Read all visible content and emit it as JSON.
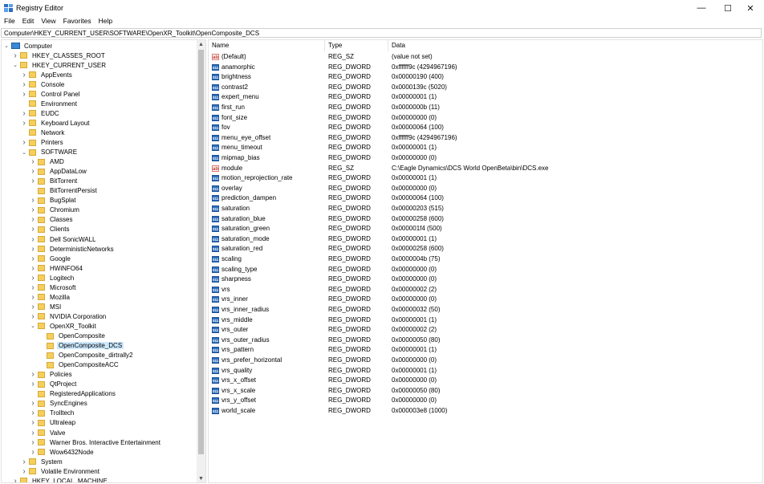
{
  "window": {
    "title": "Registry Editor",
    "minimize_glyph": "—",
    "maximize_glyph": "☐",
    "close_glyph": "✕"
  },
  "menu": [
    "File",
    "Edit",
    "View",
    "Favorites",
    "Help"
  ],
  "address_path": "Computer\\HKEY_CURRENT_USER\\SOFTWARE\\OpenXR_Toolkit\\OpenComposite_DCS",
  "tree": [
    {
      "label": "Computer",
      "depth": 0,
      "chev": "down",
      "icon": "computer"
    },
    {
      "label": "HKEY_CLASSES_ROOT",
      "depth": 1,
      "chev": "right"
    },
    {
      "label": "HKEY_CURRENT_USER",
      "depth": 1,
      "chev": "down"
    },
    {
      "label": "AppEvents",
      "depth": 2,
      "chev": "right"
    },
    {
      "label": "Console",
      "depth": 2,
      "chev": "right"
    },
    {
      "label": "Control Panel",
      "depth": 2,
      "chev": "right"
    },
    {
      "label": "Environment",
      "depth": 2,
      "chev": ""
    },
    {
      "label": "EUDC",
      "depth": 2,
      "chev": "right"
    },
    {
      "label": "Keyboard Layout",
      "depth": 2,
      "chev": "right"
    },
    {
      "label": "Network",
      "depth": 2,
      "chev": ""
    },
    {
      "label": "Printers",
      "depth": 2,
      "chev": "right"
    },
    {
      "label": "SOFTWARE",
      "depth": 2,
      "chev": "down"
    },
    {
      "label": "AMD",
      "depth": 3,
      "chev": "right"
    },
    {
      "label": "AppDataLow",
      "depth": 3,
      "chev": "right"
    },
    {
      "label": "BitTorrent",
      "depth": 3,
      "chev": "right"
    },
    {
      "label": "BitTorrentPersist",
      "depth": 3,
      "chev": ""
    },
    {
      "label": "BugSplat",
      "depth": 3,
      "chev": "right"
    },
    {
      "label": "Chromium",
      "depth": 3,
      "chev": "right"
    },
    {
      "label": "Classes",
      "depth": 3,
      "chev": "right"
    },
    {
      "label": "Clients",
      "depth": 3,
      "chev": "right"
    },
    {
      "label": "Dell SonicWALL",
      "depth": 3,
      "chev": "right"
    },
    {
      "label": "DeterministicNetworks",
      "depth": 3,
      "chev": "right"
    },
    {
      "label": "Google",
      "depth": 3,
      "chev": "right"
    },
    {
      "label": "HWiNFO64",
      "depth": 3,
      "chev": "right"
    },
    {
      "label": "Logitech",
      "depth": 3,
      "chev": "right"
    },
    {
      "label": "Microsoft",
      "depth": 3,
      "chev": "right"
    },
    {
      "label": "Mozilla",
      "depth": 3,
      "chev": "right"
    },
    {
      "label": "MSI",
      "depth": 3,
      "chev": "right"
    },
    {
      "label": "NVIDIA Corporation",
      "depth": 3,
      "chev": "right"
    },
    {
      "label": "OpenXR_Toolkit",
      "depth": 3,
      "chev": "down"
    },
    {
      "label": "OpenComposite",
      "depth": 4,
      "chev": ""
    },
    {
      "label": "OpenComposite_DCS",
      "depth": 4,
      "chev": "",
      "selected": true
    },
    {
      "label": "OpenComposite_dirtrally2",
      "depth": 4,
      "chev": ""
    },
    {
      "label": "OpenCompositeACC",
      "depth": 4,
      "chev": ""
    },
    {
      "label": "Policies",
      "depth": 3,
      "chev": "right"
    },
    {
      "label": "QtProject",
      "depth": 3,
      "chev": "right"
    },
    {
      "label": "RegisteredApplications",
      "depth": 3,
      "chev": ""
    },
    {
      "label": "SyncEngines",
      "depth": 3,
      "chev": "right"
    },
    {
      "label": "Trolltech",
      "depth": 3,
      "chev": "right"
    },
    {
      "label": "Ultraleap",
      "depth": 3,
      "chev": "right"
    },
    {
      "label": "Valve",
      "depth": 3,
      "chev": "right"
    },
    {
      "label": "Warner Bros. Interactive Entertainment",
      "depth": 3,
      "chev": "right"
    },
    {
      "label": "Wow6432Node",
      "depth": 3,
      "chev": "right"
    },
    {
      "label": "System",
      "depth": 2,
      "chev": "right"
    },
    {
      "label": "Volatile Environment",
      "depth": 2,
      "chev": "right"
    },
    {
      "label": "HKEY_LOCAL_MACHINE",
      "depth": 1,
      "chev": "right"
    }
  ],
  "columns": {
    "name": "Name",
    "type": "Type",
    "data": "Data"
  },
  "values": [
    {
      "name": "(Default)",
      "type": "REG_SZ",
      "data": "(value not set)",
      "icon": "sz"
    },
    {
      "name": "anamorphic",
      "type": "REG_DWORD",
      "data": "0xffffff9c (4294967196)",
      "icon": "dw"
    },
    {
      "name": "brightness",
      "type": "REG_DWORD",
      "data": "0x00000190 (400)",
      "icon": "dw"
    },
    {
      "name": "contrast2",
      "type": "REG_DWORD",
      "data": "0x0000139c (5020)",
      "icon": "dw"
    },
    {
      "name": "expert_menu",
      "type": "REG_DWORD",
      "data": "0x00000001 (1)",
      "icon": "dw"
    },
    {
      "name": "first_run",
      "type": "REG_DWORD",
      "data": "0x0000000b (11)",
      "icon": "dw"
    },
    {
      "name": "font_size",
      "type": "REG_DWORD",
      "data": "0x00000000 (0)",
      "icon": "dw"
    },
    {
      "name": "fov",
      "type": "REG_DWORD",
      "data": "0x00000064 (100)",
      "icon": "dw"
    },
    {
      "name": "menu_eye_offset",
      "type": "REG_DWORD",
      "data": "0xffffff9c (4294967196)",
      "icon": "dw"
    },
    {
      "name": "menu_timeout",
      "type": "REG_DWORD",
      "data": "0x00000001 (1)",
      "icon": "dw"
    },
    {
      "name": "mipmap_bias",
      "type": "REG_DWORD",
      "data": "0x00000000 (0)",
      "icon": "dw"
    },
    {
      "name": "module",
      "type": "REG_SZ",
      "data": "C:\\Eagle Dynamics\\DCS World OpenBeta\\bin\\DCS.exe",
      "icon": "sz"
    },
    {
      "name": "motion_reprojection_rate",
      "type": "REG_DWORD",
      "data": "0x00000001 (1)",
      "icon": "dw"
    },
    {
      "name": "overlay",
      "type": "REG_DWORD",
      "data": "0x00000000 (0)",
      "icon": "dw"
    },
    {
      "name": "prediction_dampen",
      "type": "REG_DWORD",
      "data": "0x00000064 (100)",
      "icon": "dw"
    },
    {
      "name": "saturation",
      "type": "REG_DWORD",
      "data": "0x00000203 (515)",
      "icon": "dw"
    },
    {
      "name": "saturation_blue",
      "type": "REG_DWORD",
      "data": "0x00000258 (600)",
      "icon": "dw"
    },
    {
      "name": "saturation_green",
      "type": "REG_DWORD",
      "data": "0x000001f4 (500)",
      "icon": "dw"
    },
    {
      "name": "saturation_mode",
      "type": "REG_DWORD",
      "data": "0x00000001 (1)",
      "icon": "dw"
    },
    {
      "name": "saturation_red",
      "type": "REG_DWORD",
      "data": "0x00000258 (600)",
      "icon": "dw"
    },
    {
      "name": "scaling",
      "type": "REG_DWORD",
      "data": "0x0000004b (75)",
      "icon": "dw"
    },
    {
      "name": "scaling_type",
      "type": "REG_DWORD",
      "data": "0x00000000 (0)",
      "icon": "dw"
    },
    {
      "name": "sharpness",
      "type": "REG_DWORD",
      "data": "0x00000000 (0)",
      "icon": "dw"
    },
    {
      "name": "vrs",
      "type": "REG_DWORD",
      "data": "0x00000002 (2)",
      "icon": "dw"
    },
    {
      "name": "vrs_inner",
      "type": "REG_DWORD",
      "data": "0x00000000 (0)",
      "icon": "dw"
    },
    {
      "name": "vrs_inner_radius",
      "type": "REG_DWORD",
      "data": "0x00000032 (50)",
      "icon": "dw"
    },
    {
      "name": "vrs_middle",
      "type": "REG_DWORD",
      "data": "0x00000001 (1)",
      "icon": "dw"
    },
    {
      "name": "vrs_outer",
      "type": "REG_DWORD",
      "data": "0x00000002 (2)",
      "icon": "dw"
    },
    {
      "name": "vrs_outer_radius",
      "type": "REG_DWORD",
      "data": "0x00000050 (80)",
      "icon": "dw"
    },
    {
      "name": "vrs_pattern",
      "type": "REG_DWORD",
      "data": "0x00000001 (1)",
      "icon": "dw"
    },
    {
      "name": "vrs_prefer_horizontal",
      "type": "REG_DWORD",
      "data": "0x00000000 (0)",
      "icon": "dw"
    },
    {
      "name": "vrs_quality",
      "type": "REG_DWORD",
      "data": "0x00000001 (1)",
      "icon": "dw"
    },
    {
      "name": "vrs_x_offset",
      "type": "REG_DWORD",
      "data": "0x00000000 (0)",
      "icon": "dw"
    },
    {
      "name": "vrs_x_scale",
      "type": "REG_DWORD",
      "data": "0x00000050 (80)",
      "icon": "dw"
    },
    {
      "name": "vrs_y_offset",
      "type": "REG_DWORD",
      "data": "0x00000000 (0)",
      "icon": "dw"
    },
    {
      "name": "world_scale",
      "type": "REG_DWORD",
      "data": "0x000003e8 (1000)",
      "icon": "dw"
    }
  ],
  "icon_text": {
    "sz": "ab",
    "dw": "011"
  },
  "colors": {
    "selection": "#cce8ff",
    "folder": "#f5cf5b",
    "dword_icon": "#2d6fc2",
    "sz_icon": "#c0392b"
  }
}
